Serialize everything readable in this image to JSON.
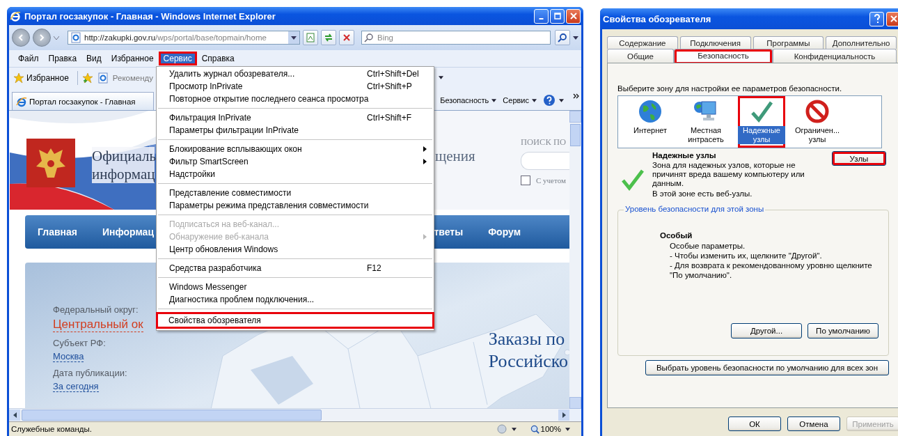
{
  "browser": {
    "title": "Портал госзакупок - Главная - Windows Internet Explorer",
    "address": {
      "host": "http://zakupki.gov.ru",
      "path": "/wps/portal/base/topmain/home"
    },
    "search": {
      "placeholder": "Bing"
    },
    "menu_bar": [
      {
        "label": "Файл",
        "selected": false,
        "annotated": false
      },
      {
        "label": "Правка",
        "selected": false,
        "annotated": false
      },
      {
        "label": "Вид",
        "selected": false,
        "annotated": false
      },
      {
        "label": "Избранное",
        "selected": false,
        "annotated": false
      },
      {
        "label": "Сервис",
        "selected": true,
        "annotated": true
      },
      {
        "label": "Справка",
        "selected": false,
        "annotated": false
      }
    ],
    "favorites_bar": {
      "favorites": "Избранное",
      "suggested": "Рекоменду"
    },
    "tab": {
      "label": "Портал госзакупок - Главная"
    },
    "command_bar": [
      {
        "label": "Безопасность"
      },
      {
        "label": "Сервис"
      }
    ],
    "page": {
      "banner_title": [
        "Официаль",
        "информац"
      ],
      "banner_title_right": "щения",
      "search_label": "ПОИСК ПО",
      "search_checkbox": {
        "label": "С учетом",
        "checked": false
      },
      "nav": [
        "Главная",
        "Информац",
        "тветы",
        "Форум"
      ],
      "filters": [
        {
          "label": "Федеральный округ:",
          "value": "Центральный ок",
          "kind": "accent"
        },
        {
          "label": "Субъект РФ:",
          "value": "Москва",
          "kind": "link"
        },
        {
          "label": "Дата публикации:",
          "value": "За сегодня",
          "kind": "link"
        }
      ],
      "headline": [
        "Заказы по",
        "Российско"
      ]
    },
    "dropdown_menu": [
      [
        {
          "label": "Удалить журнал обозревателя...",
          "shortcut": "Ctrl+Shift+Del",
          "submenu": false,
          "disabled": false,
          "annotated": false
        },
        {
          "label": "Просмотр InPrivate",
          "shortcut": "Ctrl+Shift+P",
          "submenu": false,
          "disabled": false,
          "annotated": false
        },
        {
          "label": "Повторное открытие последнего сеанса просмотра",
          "submenu": false,
          "disabled": false,
          "annotated": false
        }
      ],
      [
        {
          "label": "Фильтрация InPrivate",
          "shortcut": "Ctrl+Shift+F",
          "submenu": false,
          "disabled": false,
          "annotated": false
        },
        {
          "label": "Параметры фильтрации InPrivate",
          "submenu": false,
          "disabled": false,
          "annotated": false
        }
      ],
      [
        {
          "label": "Блокирование всплывающих окон",
          "submenu": true,
          "disabled": false,
          "annotated": false
        },
        {
          "label": "Фильтр SmartScreen",
          "submenu": true,
          "disabled": false,
          "annotated": false
        },
        {
          "label": "Надстройки",
          "submenu": false,
          "disabled": false,
          "annotated": false
        }
      ],
      [
        {
          "label": "Представление совместимости",
          "submenu": false,
          "disabled": false,
          "annotated": false
        },
        {
          "label": "Параметры режима представления совместимости",
          "submenu": false,
          "disabled": false,
          "annotated": false
        }
      ],
      [
        {
          "label": "Подписаться на веб-канал...",
          "submenu": false,
          "disabled": true,
          "annotated": false
        },
        {
          "label": "Обнаружение веб-канала",
          "submenu": true,
          "disabled": true,
          "annotated": false
        },
        {
          "label": "Центр обновления Windows",
          "submenu": false,
          "disabled": false,
          "annotated": false
        }
      ],
      [
        {
          "label": "Средства разработчика",
          "shortcut": "F12",
          "submenu": false,
          "disabled": false,
          "annotated": false
        }
      ],
      [
        {
          "label": "Windows Messenger",
          "submenu": false,
          "disabled": false,
          "annotated": false
        },
        {
          "label": "Диагностика проблем подключения...",
          "submenu": false,
          "disabled": false,
          "annotated": false
        }
      ],
      [
        {
          "label": "Свойства обозревателя",
          "submenu": false,
          "disabled": false,
          "annotated": true
        }
      ]
    ],
    "status_bar": {
      "text": "Служебные команды.",
      "zoom": "100%"
    }
  },
  "dialog": {
    "title": "Свойства обозревателя",
    "tab_rows": [
      [
        {
          "label": "Содержание",
          "selected": false,
          "annotated": false
        },
        {
          "label": "Подключения",
          "selected": false,
          "annotated": false
        },
        {
          "label": "Программы",
          "selected": false,
          "annotated": false
        },
        {
          "label": "Дополнительно",
          "selected": false,
          "annotated": false
        }
      ],
      [
        {
          "label": "Общие",
          "selected": false,
          "annotated": false
        },
        {
          "label": "Безопасность",
          "selected": true,
          "annotated": true
        },
        {
          "label": "Конфиденциальность",
          "selected": false,
          "annotated": false
        }
      ]
    ],
    "zone_prompt": "Выберите зону для настройки ее параметров безопасности.",
    "zones": [
      {
        "label": "Интернет",
        "kind": "globe",
        "selected": false,
        "annotated": false
      },
      {
        "label": "Местная интрасеть",
        "kind": "intranet",
        "selected": false,
        "annotated": false
      },
      {
        "label": "Надежные узлы",
        "kind": "trusted",
        "selected": true,
        "annotated": true
      },
      {
        "label": "Ограничен... узлы",
        "kind": "restricted",
        "selected": false,
        "annotated": false
      }
    ],
    "zone_title": "Надежные узлы",
    "zone_description": "Зона для надежных узлов, которые не причинят вреда вашему компьютеру или данным.",
    "zone_note": "В этой зоне есть веб-узлы.",
    "sites_button": {
      "label": "Узлы",
      "annotated": true
    },
    "level_group": {
      "legend": "Уровень безопасности для этой зоны",
      "level_name": "Особый",
      "lines": [
        "Особые параметры.",
        "- Чтобы изменить их, щелкните \"Другой\".",
        "- Для возврата к рекомендованному уровню щелкните \"По умолчанию\"."
      ],
      "buttons": [
        "Другой...",
        "По умолчанию"
      ]
    },
    "reset_all_button": "Выбрать уровень безопасности по умолчанию для всех зон",
    "footer_buttons": [
      {
        "label": "ОК",
        "disabled": false
      },
      {
        "label": "Отмена",
        "disabled": false
      },
      {
        "label": "Применить",
        "disabled": true
      }
    ]
  }
}
